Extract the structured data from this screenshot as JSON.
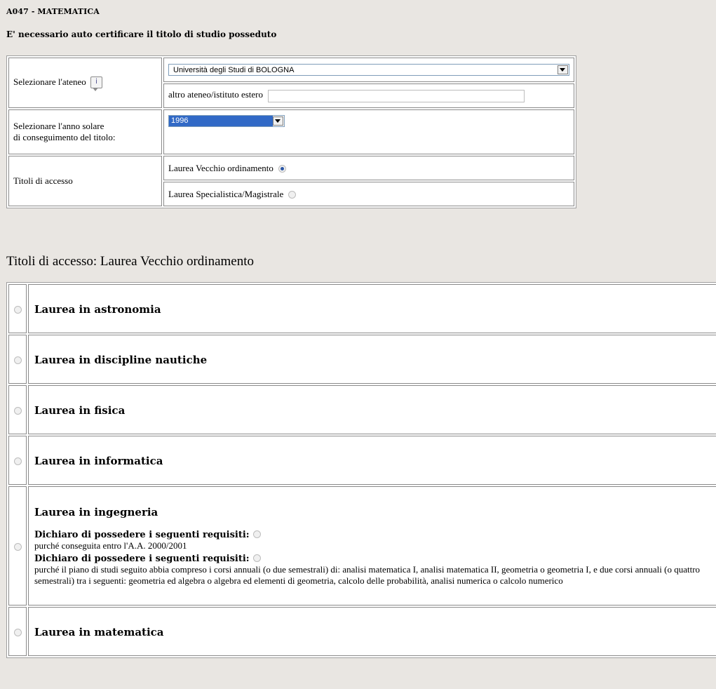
{
  "header": {
    "code_title": "A047 - MATEMATICA",
    "subtitle": "E' necessario auto certificare il titolo di studio posseduto"
  },
  "form": {
    "ateneo_label": "Selezionare l'ateneo",
    "ateneo_info_icon": "i",
    "ateneo_selected": "Università degli Studi di BOLOGNA",
    "altro_label": "altro ateneo/istituto estero",
    "altro_value": "",
    "anno_label_line1": "Selezionare l'anno solare",
    "anno_label_line2": "di conseguimento del titolo:",
    "anno_selected": "1996",
    "titoli_label": "Titoli di accesso",
    "options": [
      {
        "label": "Laurea Vecchio ordinamento",
        "checked": true
      },
      {
        "label": "Laurea Specialistica/Magistrale",
        "checked": false
      }
    ]
  },
  "section_heading": "Titoli di accesso: Laurea Vecchio ordinamento",
  "degrees": [
    {
      "title": "Laurea in astronomia"
    },
    {
      "title": "Laurea in discipline nautiche"
    },
    {
      "title": "Laurea in fisica"
    },
    {
      "title": "Laurea in informatica"
    },
    {
      "title": "Laurea in ingegneria",
      "requirements": [
        {
          "label": "Dichiaro di possedere i seguenti requisiti:",
          "text": "purché conseguita entro l'A.A. 2000/2001"
        },
        {
          "label": "Dichiaro di possedere i seguenti requisiti:",
          "text": "purché il piano di studi seguito abbia compreso i corsi annuali (o due semestrali) di: analisi matematica I, analisi matematica II, geometria o geometria I, e due corsi annuali (o quattro semestrali) tra i seguenti: geometria ed algebra o algebra ed elementi di geometria, calcolo delle probabilità, analisi numerica o calcolo numerico"
        }
      ]
    },
    {
      "title": "Laurea in matematica"
    }
  ],
  "colors": {
    "page_background": "#e9e6e2",
    "selection_highlight": "#3169c6",
    "radio_checked": "#2a56a6"
  },
  "icons": [
    "info-icon",
    "radio-icon",
    "dropdown-arrow-icon"
  ]
}
